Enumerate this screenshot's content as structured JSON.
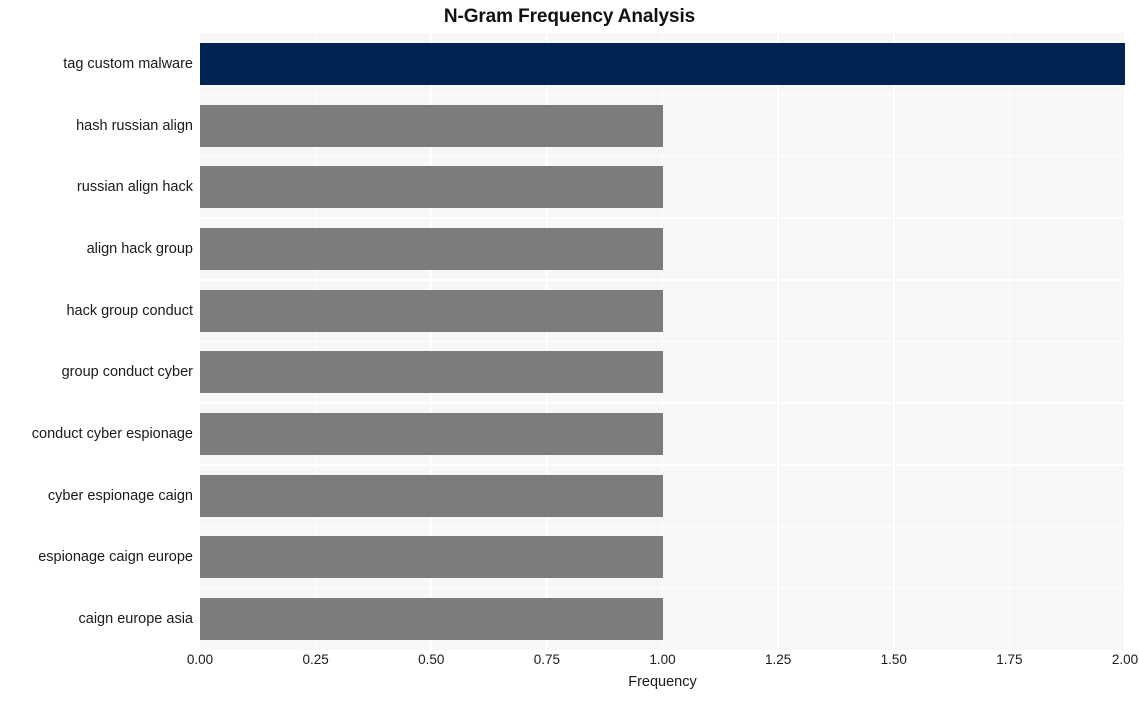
{
  "chart_data": {
    "type": "bar",
    "orientation": "horizontal",
    "title": "N-Gram Frequency Analysis",
    "xlabel": "Frequency",
    "ylabel": "",
    "categories": [
      "tag custom malware",
      "hash russian align",
      "russian align hack",
      "align hack group",
      "hack group conduct",
      "group conduct cyber",
      "conduct cyber espionage",
      "cyber espionage caign",
      "espionage caign europe",
      "caign europe asia"
    ],
    "values": [
      2,
      1,
      1,
      1,
      1,
      1,
      1,
      1,
      1,
      1
    ],
    "xlim": [
      0,
      2
    ],
    "xticks": [
      0,
      0.25,
      0.5,
      0.75,
      1,
      1.25,
      1.5,
      1.75,
      2
    ],
    "xtick_labels": [
      "0.00",
      "0.25",
      "0.50",
      "0.75",
      "1.00",
      "1.25",
      "1.50",
      "1.75",
      "2.00"
    ],
    "grid": true,
    "legend": null,
    "bar_colors": [
      "#002352",
      "#7c7c7a",
      "#7c7c7a",
      "#7c7c7a",
      "#7c7c7a",
      "#7c7c7a",
      "#7c7c7a",
      "#7c7c7a",
      "#7c7c7a",
      "#7c7c7a"
    ],
    "highlight_color": "#002352",
    "default_color": "#7c7c7a",
    "plot_background": "#f7f7f7",
    "grid_color": "#ffffff",
    "figure_background": "#ffffff"
  }
}
